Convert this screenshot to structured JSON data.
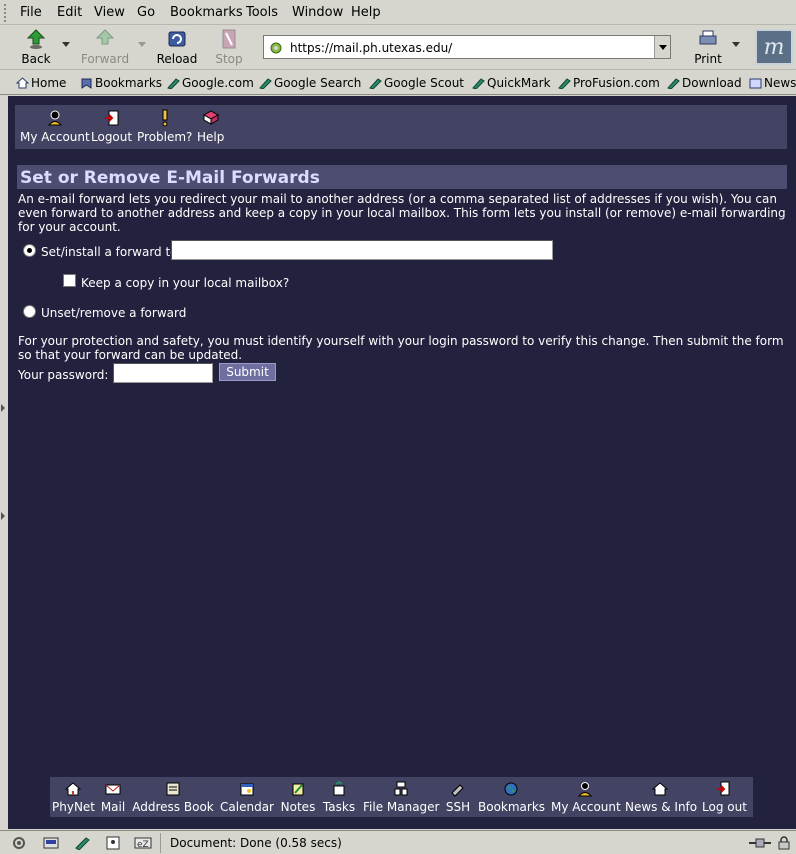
{
  "menu": {
    "items": [
      {
        "label": "File"
      },
      {
        "label": "Edit"
      },
      {
        "label": "View"
      },
      {
        "label": "Go"
      },
      {
        "label": "Bookmarks"
      },
      {
        "label": "Tools"
      },
      {
        "label": "Window"
      },
      {
        "label": "Help"
      }
    ]
  },
  "nav": {
    "back": "Back",
    "forward": "Forward",
    "reload": "Reload",
    "stop": "Stop",
    "url": "https://mail.ph.utexas.edu/",
    "print": "Print"
  },
  "bookmarks": {
    "items": [
      {
        "label": "Home"
      },
      {
        "label": "Bookmarks"
      },
      {
        "label": "Google.com"
      },
      {
        "label": "Google Search"
      },
      {
        "label": "Google Scout"
      },
      {
        "label": "QuickMark"
      },
      {
        "label": "ProFusion.com"
      },
      {
        "label": "Download"
      },
      {
        "label": "News"
      }
    ]
  },
  "topnav": {
    "items": [
      {
        "label": "My Account",
        "icon": "account-icon"
      },
      {
        "label": "Logout",
        "icon": "logout-icon"
      },
      {
        "label": "Problem?",
        "icon": "exclamation-icon"
      },
      {
        "label": "Help",
        "icon": "help-book-icon"
      }
    ]
  },
  "page": {
    "title": "Set or Remove E-Mail Forwards",
    "intro": "An e-mail forward lets you redirect your mail to another address (or a comma separated list of addresses if you wish). You can even forward to another address and keep a copy in your local mailbox.   This form lets you install (or remove) e-mail forwarding for your account.",
    "set_label": "Set/install a forward to:",
    "forward_value": "",
    "keep_copy_label": "Keep a copy in your local mailbox?",
    "unset_label": "Unset/remove a forward",
    "protection_text": "For your protection and safety, you must identify yourself with your login password to verify this change.  Then submit the form so that your forward can be updated.",
    "password_label": "Your password:",
    "password_value": "",
    "submit_label": "Submit"
  },
  "bottomnav": {
    "items": [
      {
        "label": "PhyNet",
        "icon": "home-icon"
      },
      {
        "label": "Mail",
        "icon": "mail-icon"
      },
      {
        "label": "Address Book",
        "icon": "address-book-icon"
      },
      {
        "label": "Calendar",
        "icon": "calendar-icon"
      },
      {
        "label": "Notes",
        "icon": "notes-icon"
      },
      {
        "label": "Tasks",
        "icon": "tasks-icon"
      },
      {
        "label": "File Manager",
        "icon": "file-manager-icon"
      },
      {
        "label": "SSH",
        "icon": "ssh-icon"
      },
      {
        "label": "Bookmarks",
        "icon": "globe-icon"
      },
      {
        "label": "My Account",
        "icon": "account-icon"
      },
      {
        "label": "News & Info",
        "icon": "news-icon"
      },
      {
        "label": "Log out",
        "icon": "logout-icon"
      }
    ]
  },
  "status": {
    "text": "Document: Done (0.58 secs)"
  },
  "colors": {
    "content_bg": "#22223f",
    "nav_bg": "#434363",
    "title_bg": "#4d4d72",
    "chrome_bg": "#d6d6ce"
  }
}
